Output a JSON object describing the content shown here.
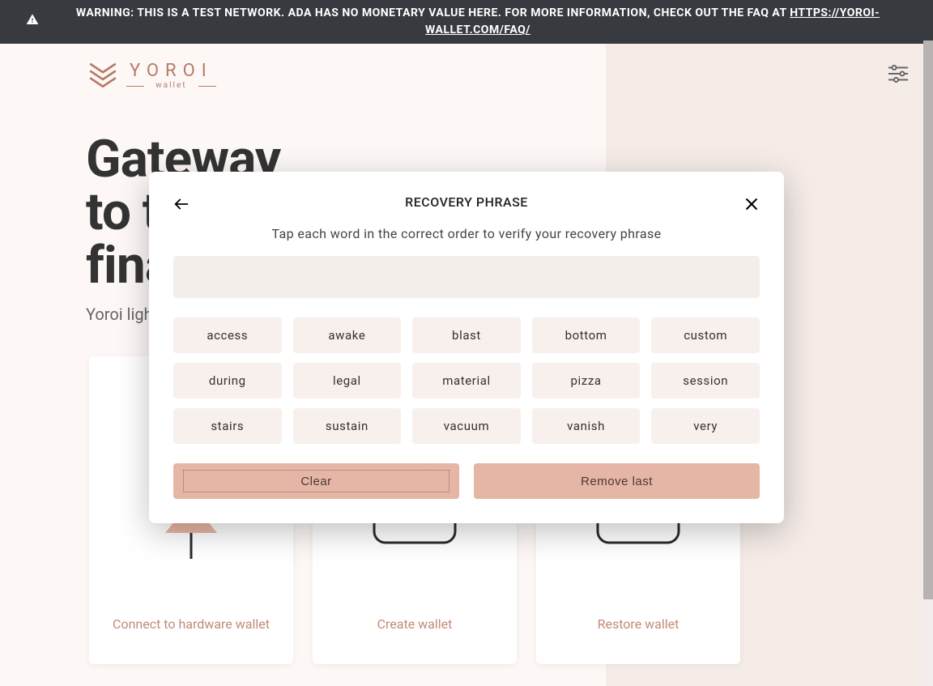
{
  "warning": {
    "prefix": "WARNING: THIS IS A TEST NETWORK. ADA HAS NO MONETARY VALUE HERE. FOR MORE INFORMATION, CHECK OUT THE FAQ AT ",
    "link_text": "HTTPS://YOROI-WALLET.COM/FAQ/"
  },
  "header": {
    "brand": "YOROI",
    "brand_sub": "wallet"
  },
  "hero": {
    "line1": "Gateway",
    "line2": "to the",
    "line3": "financial world",
    "tagline": "Yoroi light wallet for Cardano assets"
  },
  "cards": [
    {
      "title": "Connect to hardware wallet"
    },
    {
      "title": "Create wallet"
    },
    {
      "title": "Restore wallet"
    }
  ],
  "modal": {
    "title": "RECOVERY PHRASE",
    "instruction": "Tap each word in the correct order to verify your recovery phrase",
    "words": [
      "access",
      "awake",
      "blast",
      "bottom",
      "custom",
      "during",
      "legal",
      "material",
      "pizza",
      "session",
      "stairs",
      "sustain",
      "vacuum",
      "vanish",
      "very"
    ],
    "clear_label": "Clear",
    "remove_label": "Remove last"
  },
  "colors": {
    "accent": "#c18a76",
    "chip_bg": "#f8f0ec",
    "btn_bg": "#e5b5a5"
  }
}
